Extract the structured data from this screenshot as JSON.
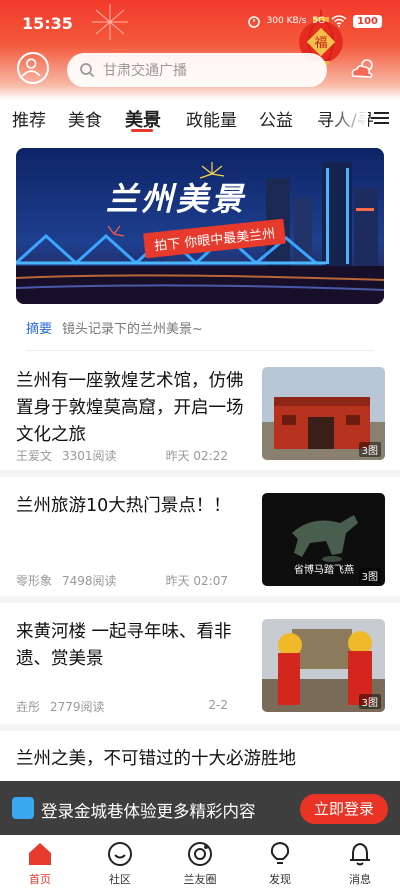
{
  "status": {
    "time": "15:35",
    "network_speed": "300 KB/s",
    "signal": "5G",
    "battery": "100"
  },
  "header": {
    "search_placeholder": "甘肃交通广播",
    "icons": [
      "user-icon",
      "search-icon",
      "weather-icon"
    ]
  },
  "tabs": [
    {
      "label": "推荐",
      "active": false
    },
    {
      "label": "美食",
      "active": false
    },
    {
      "label": "美景",
      "active": true
    },
    {
      "label": "政能量",
      "active": false
    },
    {
      "label": "公益",
      "active": false
    },
    {
      "label": "寻人/寻",
      "active": false
    }
  ],
  "banner": {
    "title": "兰州美景",
    "subtitle": "拍下 你眼中最美兰州"
  },
  "summary": {
    "label": "摘要",
    "text": "镜头记录下的兰州美景~"
  },
  "articles": [
    {
      "title": "兰州有一座敦煌艺术馆，仿佛置身于敦煌莫高窟，开启一场文化之旅",
      "author": "王爱文",
      "reads": "3301阅读",
      "time": "昨天 02:22",
      "images": "3图"
    },
    {
      "title": "兰州旅游10大热门景点！！",
      "author": "零形象",
      "reads": "7498阅读",
      "time": "昨天 02:07",
      "images": "3图",
      "thumb_caption": "省博马踏飞燕"
    },
    {
      "title": "来黄河楼 一起寻年味、看非遗、赏美景",
      "author": "垚彤",
      "reads": "2779阅读",
      "time": "2-2",
      "images": "3图"
    }
  ],
  "last_article": {
    "title": "兰州之美，不可错过的十大必游胜地"
  },
  "login_bar": {
    "text": "登录金城巷体验更多精彩内容",
    "button": "立即登录"
  },
  "bottom_nav": [
    {
      "label": "首页",
      "active": true
    },
    {
      "label": "社区",
      "active": false
    },
    {
      "label": "兰友圈",
      "active": false
    },
    {
      "label": "发现",
      "active": false
    },
    {
      "label": "消息",
      "active": false
    }
  ],
  "colors": {
    "accent": "#e53a2c",
    "link": "#2b6be0"
  }
}
